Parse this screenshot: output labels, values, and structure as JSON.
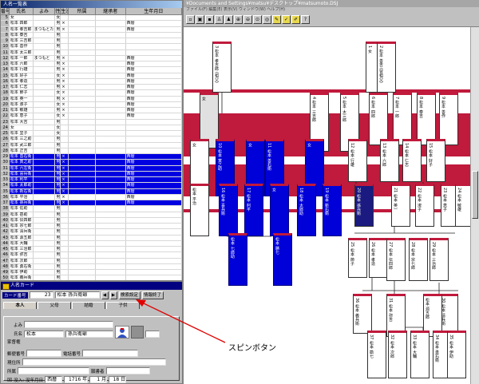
{
  "list_window": {
    "title": "人名一覧表",
    "columns": [
      "番号",
      "氏名",
      "よみ",
      "性別",
      "生没",
      "所属",
      "継承者",
      "生年月日"
    ],
    "rows": [
      {
        "no": "5",
        "name": "女",
        "yomi": "",
        "sex": "女",
        "alive": "",
        "extra": "",
        "sel": false
      },
      {
        "no": "6",
        "name": "松本 四郎",
        "yomi": "",
        "sex": "男",
        "alive": "×",
        "extra": "西暦",
        "sel": false
      },
      {
        "no": "7",
        "name": "松本 孝吉郎",
        "yomi": "まつもとたかき",
        "sex": "男",
        "alive": "×",
        "extra": "西暦",
        "sel": false
      },
      {
        "no": "8",
        "name": "松本 泰吉",
        "yomi": "",
        "sex": "男",
        "alive": "",
        "extra": "",
        "sel": false
      },
      {
        "no": "9",
        "name": "松本 三吉郎",
        "yomi": "",
        "sex": "男",
        "alive": "",
        "extra": "",
        "sel": false
      },
      {
        "no": "10",
        "name": "松本 善作",
        "yomi": "",
        "sex": "男",
        "alive": "",
        "extra": "",
        "sel": false
      },
      {
        "no": "11",
        "name": "松本 太三郎",
        "yomi": "",
        "sex": "男",
        "alive": "",
        "extra": "",
        "sel": false
      },
      {
        "no": "12",
        "name": "松本 一郎",
        "yomi": "まつもと",
        "sex": "男",
        "alive": "×",
        "extra": "西暦",
        "sel": false
      },
      {
        "no": "13",
        "name": "松本 六郎",
        "yomi": "",
        "sex": "男",
        "alive": "×",
        "extra": "西暦",
        "sel": false
      },
      {
        "no": "14",
        "name": "松本 行雄",
        "yomi": "",
        "sex": "男",
        "alive": "×",
        "extra": "西暦",
        "sel": false
      },
      {
        "no": "15",
        "name": "松本 好子",
        "yomi": "",
        "sex": "女",
        "alive": "×",
        "extra": "西暦",
        "sel": false
      },
      {
        "no": "16",
        "name": "松本 孝造",
        "yomi": "",
        "sex": "男",
        "alive": "×",
        "extra": "西暦",
        "sel": false
      },
      {
        "no": "17",
        "name": "松本 仁志",
        "yomi": "",
        "sex": "男",
        "alive": "×",
        "extra": "西暦",
        "sel": false
      },
      {
        "no": "18",
        "name": "松本 節子",
        "yomi": "",
        "sex": "女",
        "alive": "×",
        "extra": "西暦",
        "sel": false
      },
      {
        "no": "19",
        "name": "松本 英一",
        "yomi": "",
        "sex": "男",
        "alive": "×",
        "extra": "西暦",
        "sel": false
      },
      {
        "no": "20",
        "name": "松本 淑子",
        "yomi": "",
        "sex": "女",
        "alive": "×",
        "extra": "西暦",
        "sel": false
      },
      {
        "no": "21",
        "name": "松本 敏雄",
        "yomi": "",
        "sex": "男",
        "alive": "×",
        "extra": "西暦",
        "sel": false
      },
      {
        "no": "22",
        "name": "松本 恵子",
        "yomi": "",
        "sex": "女",
        "alive": "×",
        "extra": "西暦",
        "sel": false
      },
      {
        "no": "23",
        "name": "松本 大吉",
        "yomi": "",
        "sex": "男",
        "alive": "",
        "extra": "",
        "sel": false
      },
      {
        "no": "24",
        "name": "女",
        "yomi": "",
        "sex": "女",
        "alive": "",
        "extra": "",
        "sel": false
      },
      {
        "no": "25",
        "name": "松本 里子",
        "yomi": "",
        "sex": "女",
        "alive": "",
        "extra": "",
        "sel": false
      },
      {
        "no": "26",
        "name": "松本 三之助",
        "yomi": "",
        "sex": "男",
        "alive": "",
        "extra": "",
        "sel": false
      },
      {
        "no": "27",
        "name": "松本 武三郎",
        "yomi": "",
        "sex": "男",
        "alive": "",
        "extra": "",
        "sel": false
      },
      {
        "no": "28",
        "name": "松本 正吉",
        "yomi": "",
        "sex": "男",
        "alive": "",
        "extra": "",
        "sel": false
      },
      {
        "no": "29",
        "name": "松本 善右衛",
        "yomi": "",
        "sex": "男",
        "alive": "×",
        "extra": "西暦",
        "sel": true
      },
      {
        "no": "30",
        "name": "松本 寅之助",
        "yomi": "",
        "sex": "男",
        "alive": "×",
        "extra": "西暦",
        "sel": true
      },
      {
        "no": "31",
        "name": "松本 六左衛",
        "yomi": "",
        "sex": "男",
        "alive": "×",
        "extra": "西暦",
        "sel": true
      },
      {
        "no": "32",
        "name": "松本 喜兵衛",
        "yomi": "",
        "sex": "男",
        "alive": "×",
        "extra": "西暦",
        "sel": true
      },
      {
        "no": "33",
        "name": "松本 利平",
        "yomi": "",
        "sex": "男",
        "alive": "×",
        "extra": "西暦",
        "sel": true
      },
      {
        "no": "34",
        "name": "松本 太郎助",
        "yomi": "",
        "sex": "男",
        "alive": "×",
        "extra": "西暦",
        "sel": true
      },
      {
        "no": "35",
        "name": "松本 新右衛",
        "yomi": "",
        "sex": "男",
        "alive": "×",
        "extra": "西暦",
        "sel": true
      },
      {
        "no": "36",
        "name": "松本 平治",
        "yomi": "",
        "sex": "男",
        "alive": "×",
        "extra": "西暦",
        "sel": false
      },
      {
        "no": "37",
        "name": "松本 孫兵衛",
        "yomi": "",
        "sex": "男",
        "alive": "×",
        "extra": "西暦",
        "sel": true
      },
      {
        "no": "38",
        "name": "松本 佐助",
        "yomi": "",
        "sex": "男",
        "alive": "",
        "extra": "",
        "sel": false
      },
      {
        "no": "39",
        "name": "松本 甚助",
        "yomi": "",
        "sex": "男",
        "alive": "",
        "extra": "",
        "sel": false
      },
      {
        "no": "40",
        "name": "松本 伝四郎",
        "yomi": "",
        "sex": "男",
        "alive": "",
        "extra": "",
        "sel": false
      },
      {
        "no": "41",
        "name": "松本 宗七郎",
        "yomi": "",
        "sex": "男",
        "alive": "",
        "extra": "",
        "sel": false
      },
      {
        "no": "42",
        "name": "松本 清兵衛",
        "yomi": "",
        "sex": "男",
        "alive": "",
        "extra": "",
        "sel": false
      },
      {
        "no": "43",
        "name": "松本 源五郎",
        "yomi": "",
        "sex": "男",
        "alive": "",
        "extra": "",
        "sel": false
      },
      {
        "no": "44",
        "name": "松本 大輔",
        "yomi": "",
        "sex": "男",
        "alive": "",
        "extra": "",
        "sel": false
      },
      {
        "no": "45",
        "name": "松本 三治郎",
        "yomi": "",
        "sex": "男",
        "alive": "",
        "extra": "",
        "sel": false
      },
      {
        "no": "46",
        "name": "松本 弥吉",
        "yomi": "",
        "sex": "男",
        "alive": "",
        "extra": "",
        "sel": false
      },
      {
        "no": "47",
        "name": "松本 次郎",
        "yomi": "",
        "sex": "男",
        "alive": "",
        "extra": "",
        "sel": false
      },
      {
        "no": "48",
        "name": "松本 勇右衛",
        "yomi": "",
        "sex": "男",
        "alive": "",
        "extra": "",
        "sel": false
      },
      {
        "no": "49",
        "name": "松本 伊助",
        "yomi": "",
        "sex": "男",
        "alive": "",
        "extra": "",
        "sel": false
      },
      {
        "no": "50",
        "name": "松本 義兵衛",
        "yomi": "",
        "sex": "男",
        "alive": "",
        "extra": "",
        "sel": false
      },
      {
        "no": "51",
        "name": "松本 勘七",
        "yomi": "",
        "sex": "男",
        "alive": "",
        "extra": "",
        "sel": false
      }
    ]
  },
  "card": {
    "title": "人名カード",
    "card_no_label": "カード番号",
    "card_no": "23",
    "name_display": "松本 孫兵衛爺",
    "prev_btn": "◀",
    "next_btn": "▶",
    "search_btn": "検索設定",
    "close_btn": "情報終了",
    "tabs": [
      "本人",
      "父母",
      "結婚",
      "子供"
    ],
    "yomi_label": "よみ",
    "name_label": "氏名",
    "surname": "松本",
    "given_name": "孫兵衛爺",
    "heir_label": "家督権",
    "postal_label": "郵便番号",
    "phone_label": "電話番号",
    "address_label": "現住所",
    "honseki_label": "所属",
    "seki_label": "願書者",
    "death_label": "没入:",
    "death_check": "☒",
    "death_era": "没年月日",
    "death_cal": "西暦",
    "death_year": "1716 年",
    "death_month": "1 月",
    "death_day": "18 日"
  },
  "tree_window": {
    "title": "¥Documents and Settings¥matsu¥デスクトップ¥matsumoto.DSJ",
    "menu": "ファイル(F)  編集(E)  表示(V)  ウィンドウ(W)  ヘルプ(H)"
  },
  "tree": {
    "people": [
      {
        "label": "3 松本 孝吉郎 (祖父)",
        "style": "white"
      },
      {
        "label": "1 女",
        "style": "white"
      },
      {
        "label": "2 松本 善吉 (曾祖父)",
        "style": "white"
      },
      {
        "label": "女",
        "style": "gray"
      },
      {
        "label": "4 松本 三吉郎",
        "style": "white"
      },
      {
        "label": "5 松本 太三郎",
        "style": "white"
      },
      {
        "label": "6 松本 四郎",
        "style": "white"
      },
      {
        "label": "7 松本 一郎",
        "style": "white"
      },
      {
        "label": "8 松本 泰吉",
        "style": "white"
      },
      {
        "label": "9 松本 善作",
        "style": "white"
      },
      {
        "label": "女",
        "style": "white"
      },
      {
        "label": "10 松本 寅之助",
        "style": "blue"
      },
      {
        "label": "女",
        "style": "blue"
      },
      {
        "label": "11 松本 善右衛",
        "style": "blue"
      },
      {
        "label": "女",
        "style": "blue"
      },
      {
        "label": "12 松本 行雄",
        "style": "white"
      },
      {
        "label": "13 松本 六郎",
        "style": "white"
      },
      {
        "label": "14 松本 仁志",
        "style": "white"
      },
      {
        "label": "15 松本 好子",
        "style": "white"
      },
      {
        "label": "松本 平治",
        "style": "white"
      },
      {
        "label": "16 松本 喜兵衛",
        "style": "blue"
      },
      {
        "label": "17 松本 利平",
        "style": "blue"
      },
      {
        "label": "女",
        "style": "blue"
      },
      {
        "label": "18 松本 太郎助",
        "style": "blue"
      },
      {
        "label": "19 松本 新右衛",
        "style": "blue"
      },
      {
        "label": "20 松本 孫兵衛",
        "style": "dark"
      },
      {
        "label": "21 松本 英一",
        "style": "white"
      },
      {
        "label": "22 松本 淑子",
        "style": "white"
      },
      {
        "label": "23 松本 恵子",
        "style": "white"
      },
      {
        "label": "24 松本 敏雄",
        "style": "white"
      },
      {
        "label": "25 松本 節子",
        "style": "white"
      },
      {
        "label": "26 松本 孝造",
        "style": "white"
      },
      {
        "label": "松本 七郎助",
        "style": "blue"
      },
      {
        "label": "松本 勝七",
        "style": "blue"
      },
      {
        "label": "27 松本 伝四郎",
        "style": "white"
      },
      {
        "label": "28 松本 宗七郎",
        "style": "white"
      },
      {
        "label": "29 松本 三治郎",
        "style": "white"
      },
      {
        "label": "30 松本 清兵衛",
        "style": "white"
      },
      {
        "label": "松本 源五郎",
        "style": "white"
      },
      {
        "label": "31 松本 弥吉",
        "style": "white"
      },
      {
        "label": "32 松本 次郎",
        "style": "white"
      },
      {
        "label": "33 松本 大輔",
        "style": "white"
      },
      {
        "label": "34 松本 勇右衛",
        "style": "white"
      },
      {
        "label": "35 松本 伊助",
        "style": "white"
      },
      {
        "label": "36 松本 義兵衛",
        "style": "white"
      },
      {
        "label": "37 松本 勘七",
        "style": "white"
      }
    ]
  },
  "annotation": {
    "text": "スピンボタン",
    "color": "#e00000"
  }
}
